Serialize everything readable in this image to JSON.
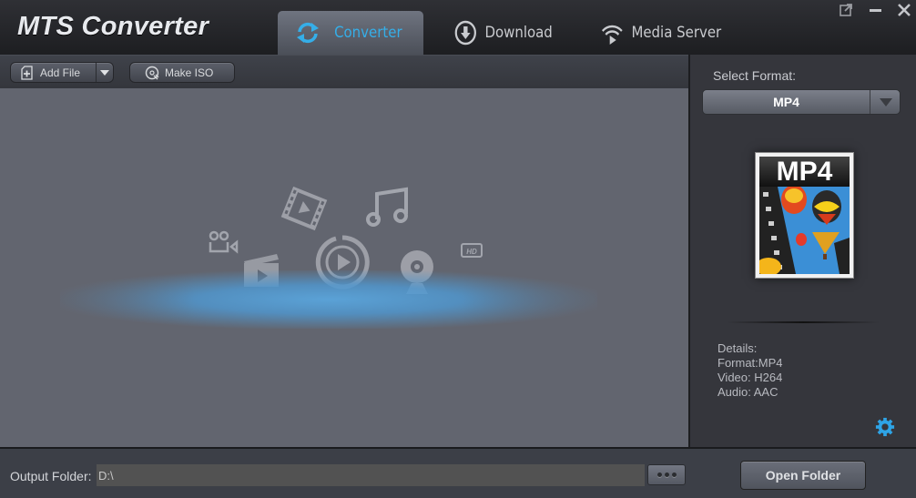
{
  "app": {
    "title": "MTS Converter"
  },
  "tabs": [
    {
      "label": "Converter",
      "icon": "refresh-icon",
      "active": true
    },
    {
      "label": "Download",
      "icon": "download-icon",
      "active": false
    },
    {
      "label": "Media Server",
      "icon": "wifi-play-icon",
      "active": false
    }
  ],
  "window_controls": [
    "popout-icon",
    "minimize-icon",
    "close-icon"
  ],
  "toolbar": {
    "add_file_label": "Add File",
    "make_iso_label": "Make ISO"
  },
  "side": {
    "select_format_label": "Select Format:",
    "format_value": "MP4",
    "thumb_label": "MP4",
    "details": {
      "title": "Details:",
      "format": "Format:MP4",
      "video": "Video: H264",
      "audio": "Audio: AAC"
    }
  },
  "bottom": {
    "output_label": "Output Folder:",
    "output_value": "D:\\",
    "open_folder_label": "Open Folder"
  },
  "colors": {
    "accent": "#35aee8",
    "main_bg": "#62656f",
    "side_bg": "#35363c"
  }
}
